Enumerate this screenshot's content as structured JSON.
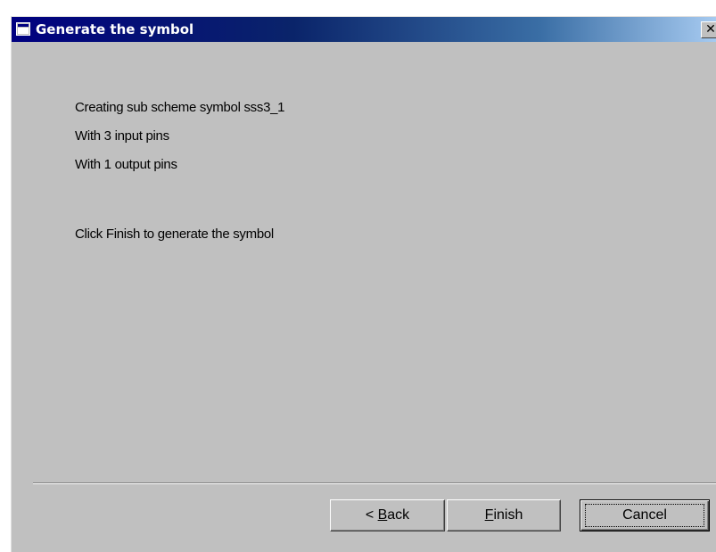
{
  "window": {
    "title": "Generate the symbol",
    "close_glyph": "✕",
    "title_icon": "window-icon",
    "colors": {
      "titlebar_start": "#000080",
      "titlebar_end": "#a6caf0",
      "face": "#c0c0c0"
    }
  },
  "messages": [
    "Creating sub scheme symbol sss3_1",
    "With 3 input pins",
    "With 1 output pins",
    "Click Finish to generate the symbol"
  ],
  "buttons": {
    "back": {
      "prefix": "< ",
      "mnemonic": "B",
      "rest": "ack"
    },
    "finish": {
      "prefix": "",
      "mnemonic": "F",
      "rest": "inish"
    },
    "cancel": {
      "label": "Cancel"
    }
  }
}
